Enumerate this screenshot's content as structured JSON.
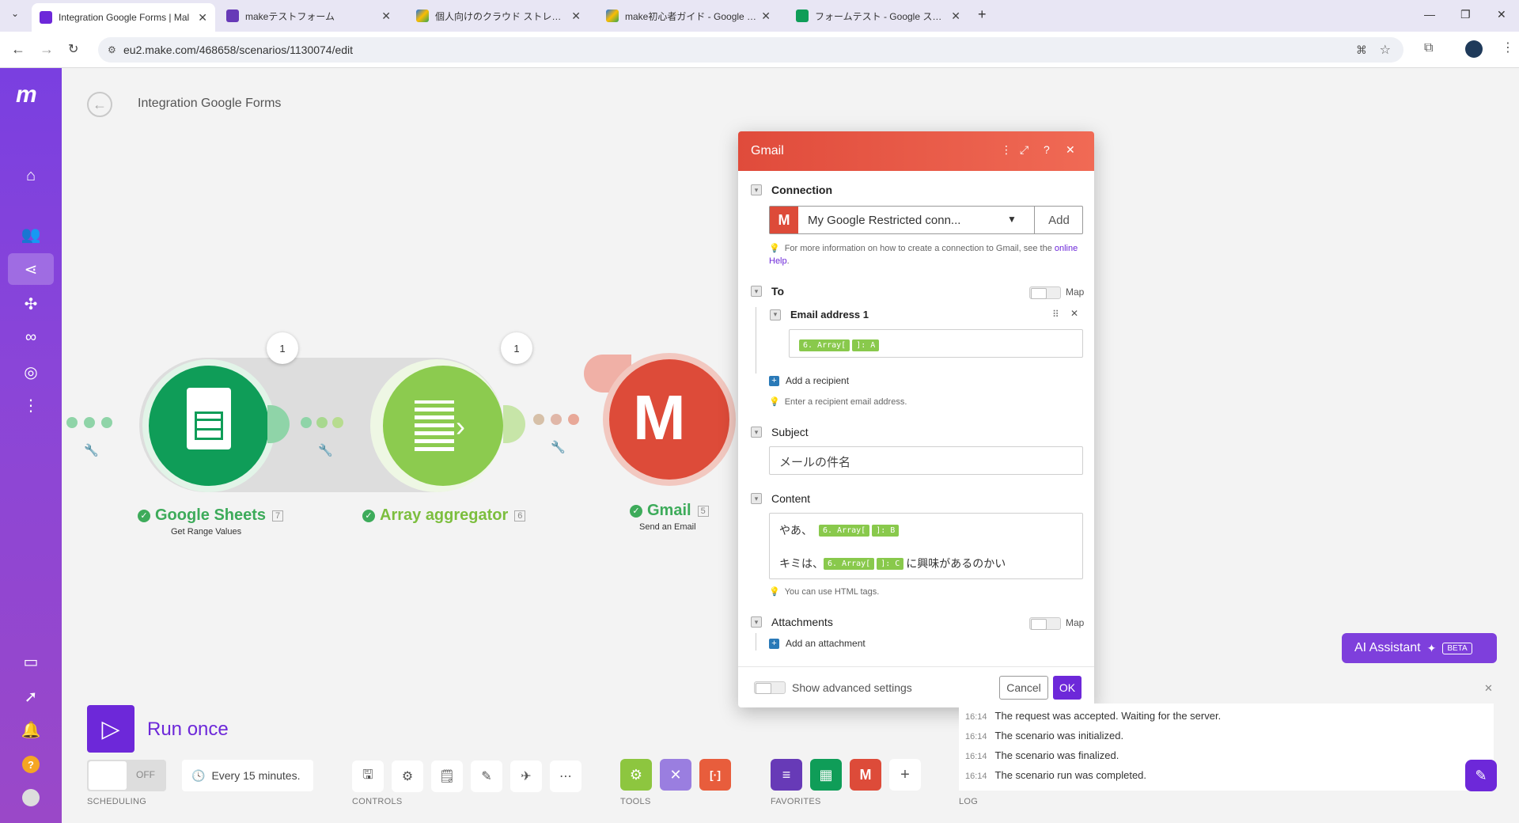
{
  "browser": {
    "tabs": [
      {
        "title": "Integration Google Forms | Mal",
        "active": true,
        "color": "#6d28d9"
      },
      {
        "title": "makeテストフォーム",
        "active": false,
        "color": "#673ab7"
      },
      {
        "title": "個人向けのクラウド ストレージおよび",
        "active": false,
        "color": "#1a73e8"
      },
      {
        "title": "make初心者ガイド - Google ドラ",
        "active": false,
        "color": "#1a73e8"
      },
      {
        "title": "フォームテスト - Google スプレッドシ",
        "active": false,
        "color": "#0f9d58"
      }
    ],
    "url": "eu2.make.com/468658/scenarios/1130074/edit"
  },
  "header": {
    "back_icon": "arrow-left-icon",
    "title": "Integration Google Forms"
  },
  "modules": [
    {
      "name": "Google Sheets",
      "id": "7",
      "action": "Get Range Values",
      "color": "#0f9d58",
      "bubble": "1"
    },
    {
      "name": "Array aggregator",
      "id": "6",
      "action": "",
      "color": "#8ccb4f",
      "bubble": "1"
    },
    {
      "name": "Gmail",
      "id": "5",
      "action": "Send an Email",
      "color": "#dd4b39"
    }
  ],
  "dialog": {
    "title": "Gmail",
    "connection": {
      "label": "Connection",
      "value": "My Google Restricted conn...",
      "add_label": "Add",
      "hint_text": "For more information on how to create a connection to Gmail, see the ",
      "hint_link": "online Help",
      "hint_end": "."
    },
    "to": {
      "label": "To",
      "map_label": "Map",
      "email_label": "Email address 1",
      "email_pills": [
        "6. Array[",
        "]: A"
      ],
      "add_label": "Add a recipient",
      "hint": "Enter a recipient email address."
    },
    "subject": {
      "label": "Subject",
      "value": "メールの件名"
    },
    "content": {
      "label": "Content",
      "line1_prefix": "やあ、",
      "line1_pills": [
        "6. Array[",
        "]: B"
      ],
      "line2_prefix": "キミは、",
      "line2_pills": [
        "6. Array[",
        "]: C"
      ],
      "line2_suffix": "に興味があるのかい",
      "hint": "You can use HTML tags."
    },
    "attachments": {
      "label": "Attachments",
      "map_label": "Map",
      "add_label": "Add an attachment"
    },
    "advanced_label": "Show advanced settings",
    "cancel_label": "Cancel",
    "ok_label": "OK"
  },
  "ai_assistant": {
    "label": "AI Assistant",
    "badge": "BETA"
  },
  "toolbar": {
    "run_once": "Run once",
    "scheduling_toggle": "OFF",
    "schedule": "Every 15 minutes.",
    "sections": [
      "SCHEDULING",
      "CONTROLS",
      "TOOLS",
      "FAVORITES",
      "LOG"
    ]
  },
  "log": [
    {
      "time": "16:14",
      "text": "The request was accepted. Waiting for the server."
    },
    {
      "time": "16:14",
      "text": "The scenario was initialized."
    },
    {
      "time": "16:14",
      "text": "The scenario was finalized."
    },
    {
      "time": "16:14",
      "text": "The scenario run was completed."
    }
  ],
  "colors": {
    "accent": "#6d28d9",
    "gmail": "#dd4b39",
    "sheets": "#0f9d58",
    "aggregator": "#8ccb4f",
    "tools": "#8dc63f"
  }
}
